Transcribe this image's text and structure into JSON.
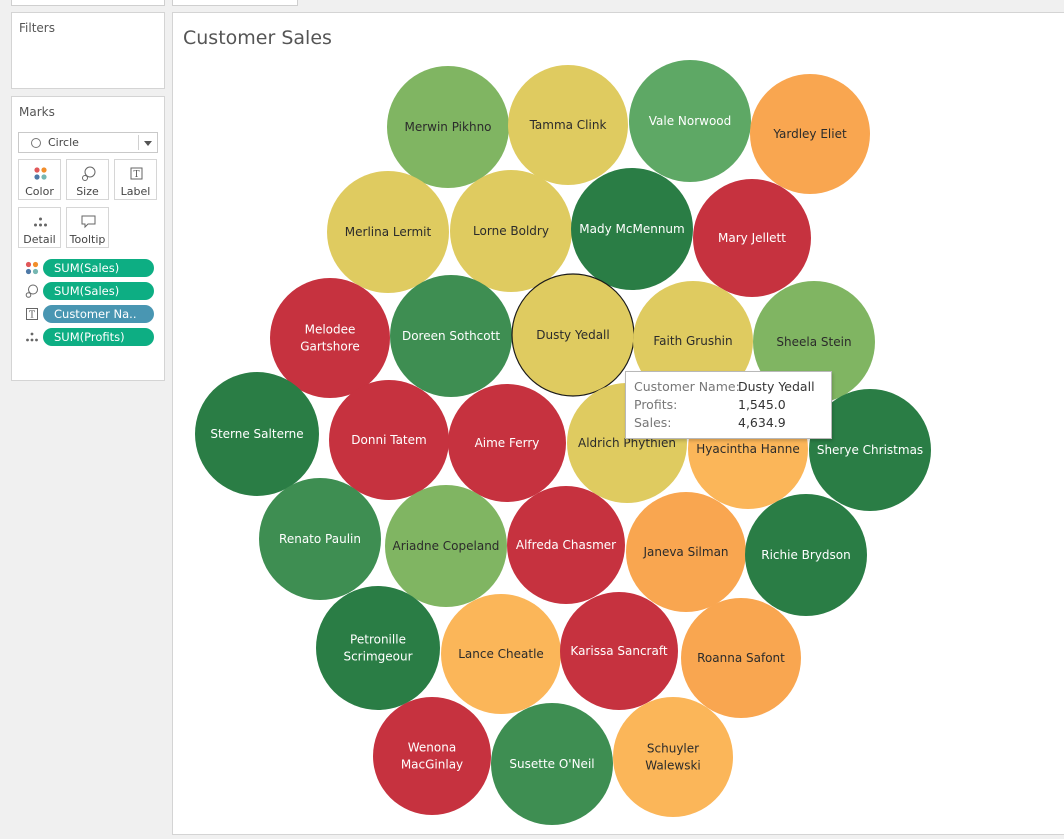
{
  "filters": {
    "title": "Filters"
  },
  "marks": {
    "title": "Marks",
    "mark_type": "Circle",
    "buttons": {
      "color": "Color",
      "size": "Size",
      "label": "Label",
      "detail": "Detail",
      "tooltip": "Tooltip"
    },
    "shelf": [
      {
        "role": "color",
        "field": "SUM(Sales)"
      },
      {
        "role": "size",
        "field": "SUM(Sales)"
      },
      {
        "role": "label",
        "field": "Customer Na.."
      },
      {
        "role": "detail",
        "field": "SUM(Profits)"
      }
    ]
  },
  "sheet": {
    "title": "Customer Sales"
  },
  "palette": {
    "dark_green": "#2a7d45",
    "green": "#3e8e52",
    "mid_green": "#5ea865",
    "light_green": "#80b562",
    "yellow": "#dfcb60",
    "light_orange": "#fbb659",
    "orange": "#f9a650",
    "red": "#c6323f",
    "pill_green": "#0dae83",
    "pill_blue": "#4996b2"
  },
  "bubbles": [
    {
      "lines": [
        "Merwin Pikhno"
      ],
      "color": "light_green"
    },
    {
      "lines": [
        "Tamma Clink"
      ],
      "color": "yellow"
    },
    {
      "lines": [
        "Vale Norwood"
      ],
      "color": "mid_green"
    },
    {
      "lines": [
        "Yardley Eliet"
      ],
      "color": "orange"
    },
    {
      "lines": [
        "Merlina Lermit"
      ],
      "color": "yellow"
    },
    {
      "lines": [
        "Lorne Boldry"
      ],
      "color": "yellow"
    },
    {
      "lines": [
        "Mady McMennum"
      ],
      "color": "dark_green"
    },
    {
      "lines": [
        "Mary Jellett"
      ],
      "color": "red"
    },
    {
      "lines": [
        "Melodee",
        "Gartshore"
      ],
      "color": "red"
    },
    {
      "lines": [
        "Doreen Sothcott"
      ],
      "color": "green"
    },
    {
      "lines": [
        "Dusty Yedall"
      ],
      "color": "yellow",
      "selected": true
    },
    {
      "lines": [
        "Faith Grushin"
      ],
      "color": "yellow"
    },
    {
      "lines": [
        "Sheela Stein"
      ],
      "color": "light_green"
    },
    {
      "lines": [
        "Sterne Salterne"
      ],
      "color": "dark_green"
    },
    {
      "lines": [
        "Donni Tatem"
      ],
      "color": "red"
    },
    {
      "lines": [
        "Aime Ferry"
      ],
      "color": "red"
    },
    {
      "lines": [
        "Aldrich Phythien"
      ],
      "color": "yellow"
    },
    {
      "lines": [
        "Hyacintha Hanne"
      ],
      "color": "light_orange"
    },
    {
      "lines": [
        "Sherye Christmas"
      ],
      "color": "dark_green"
    },
    {
      "lines": [
        "Renato Paulin"
      ],
      "color": "green"
    },
    {
      "lines": [
        "Ariadne Copeland"
      ],
      "color": "light_green"
    },
    {
      "lines": [
        "Alfreda Chasmer"
      ],
      "color": "red"
    },
    {
      "lines": [
        "Janeva Silman"
      ],
      "color": "orange"
    },
    {
      "lines": [
        "Richie Brydson"
      ],
      "color": "dark_green"
    },
    {
      "lines": [
        "Petronille",
        "Scrimgeour"
      ],
      "color": "dark_green"
    },
    {
      "lines": [
        "Lance Cheatle"
      ],
      "color": "light_orange"
    },
    {
      "lines": [
        "Karissa Sancraft"
      ],
      "color": "red"
    },
    {
      "lines": [
        "Roanna Safont"
      ],
      "color": "orange"
    },
    {
      "lines": [
        "Wenona",
        "MacGinlay"
      ],
      "color": "red"
    },
    {
      "lines": [
        "Susette O'Neil"
      ],
      "color": "green"
    },
    {
      "lines": [
        "Schuyler",
        "Walewski"
      ],
      "color": "light_orange"
    }
  ],
  "tooltip": {
    "rows": [
      {
        "key": "Customer Name:",
        "value": "Dusty Yedall"
      },
      {
        "key": "Profits:",
        "value": "1,545.0"
      },
      {
        "key": "Sales:",
        "value": "4,634.9"
      }
    ]
  }
}
